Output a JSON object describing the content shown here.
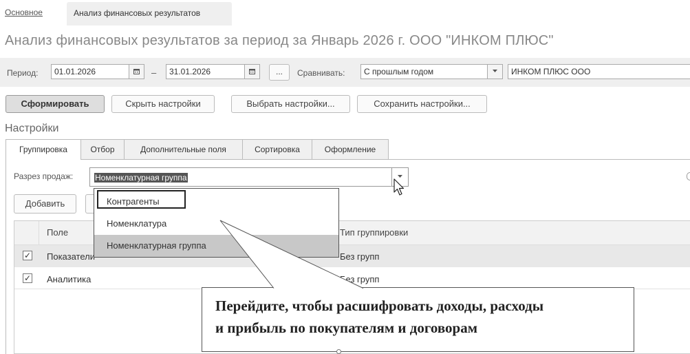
{
  "tabs": {
    "main": "Основное",
    "active": "Анализ финансовых результатов"
  },
  "page_title": "Анализ финансовых результатов за период за Январь 2026 г. ООО \"ИНКОМ ПЛЮС\"",
  "period": {
    "label": "Период:",
    "from": "01.01.2026",
    "dash": "–",
    "to": "31.01.2026",
    "ellipsis": "...",
    "compare_label": "Сравнивать:",
    "compare_value": "С прошлым годом",
    "org_value": "ИНКОМ ПЛЮС ООО"
  },
  "toolbar": {
    "generate": "Сформировать",
    "hide_settings": "Скрыть настройки",
    "choose_settings": "Выбрать настройки...",
    "save_settings": "Сохранить настройки..."
  },
  "settings": {
    "heading": "Настройки",
    "tabs": [
      "Группировка",
      "Отбор",
      "Дополнительные поля",
      "Сортировка",
      "Оформление"
    ],
    "sales_section_label": "Разрез продаж:",
    "sales_section_value": "Номенклатурная группа",
    "add_button": "Добавить",
    "grid": {
      "col_field": "Поле",
      "col_group_type": "Тип группировки",
      "rows": [
        {
          "checked": true,
          "field": "Показатели",
          "group_type": "Без групп"
        },
        {
          "checked": true,
          "field": "Аналитика",
          "group_type": "Без групп"
        }
      ]
    },
    "dropdown_options": [
      "Контрагенты",
      "Номенклатура",
      "Номенклатурная группа"
    ]
  },
  "callout": {
    "line1": "Перейдите, чтобы расшифровать доходы, расходы",
    "line2": "и прибыль по покупателям и договорам"
  },
  "icons": {
    "calendar": "calendar-icon",
    "dropdown": "chevron-down-icon",
    "cursor": "mouse-pointer-icon"
  }
}
